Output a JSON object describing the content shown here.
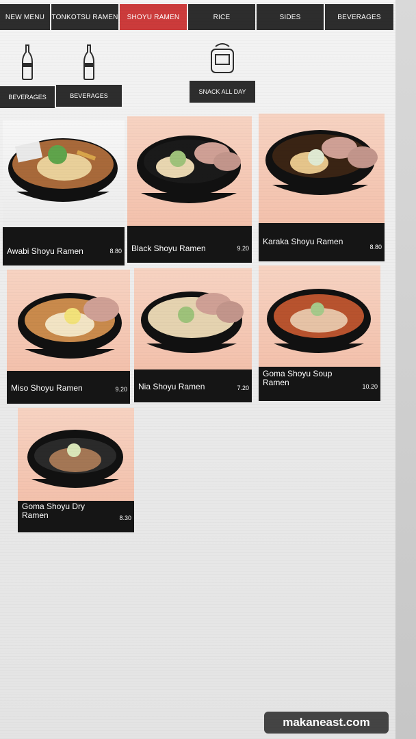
{
  "tabs": [
    {
      "label": "NEW MENU"
    },
    {
      "label": "TONKOTSU RAMEN"
    },
    {
      "label": "SHOYU RAMEN",
      "active": true
    },
    {
      "label": "RICE"
    },
    {
      "label": "SIDES"
    },
    {
      "label": "BEVERAGES"
    }
  ],
  "subcategories": [
    {
      "label": "BEVERAGES",
      "icon": "bottle-icon"
    },
    {
      "label": "BEVERAGES",
      "icon": "bottle-icon"
    },
    {
      "label": "SNACK ALL DAY",
      "icon": "toaster-icon"
    }
  ],
  "menu_items": [
    {
      "name": "Awabi Shoyu Ramen",
      "price": "8.80"
    },
    {
      "name": "Black Shoyu Ramen",
      "price": "9.20"
    },
    {
      "name": "Karaka Shoyu Ramen",
      "price": "8.80"
    },
    {
      "name": "Miso Shoyu Ramen",
      "price": "9.20"
    },
    {
      "name": "Nia Shoyu Ramen",
      "price": "7.20"
    },
    {
      "name": "Goma Shoyu Soup Ramen",
      "price": "10.20"
    },
    {
      "name": "Goma Shoyu Dry Ramen",
      "price": "8.30"
    }
  ],
  "watermark": "makaneast.com",
  "colors": {
    "tab_bg": "#2d2d2d",
    "tab_active": "#cc3b3b",
    "caption_bg": "#151515"
  }
}
